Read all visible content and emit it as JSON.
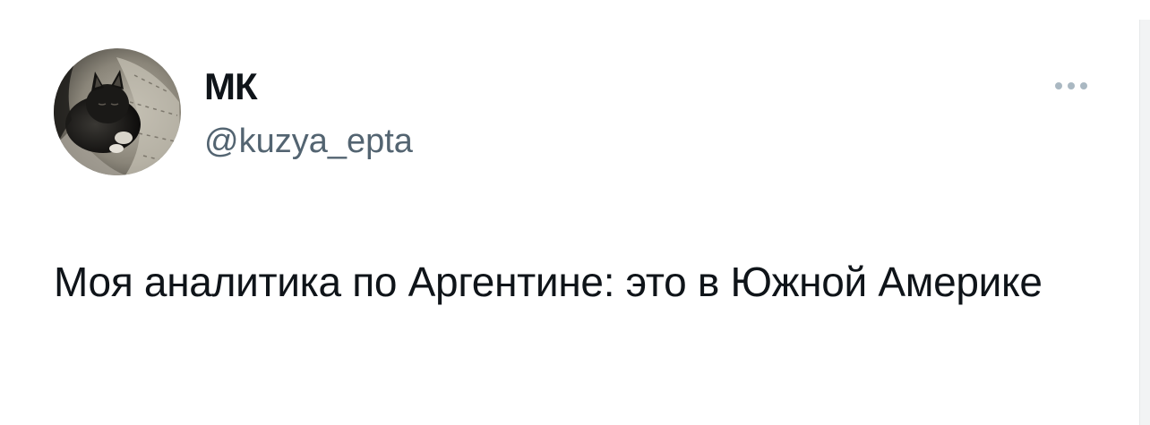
{
  "tweet": {
    "author": {
      "display_name": "МК",
      "handle": "@kuzya_epta",
      "avatar_icon": "cat-avatar-icon"
    },
    "more_icon": "more-options-icon",
    "text": "Моя аналитика по Аргентине: это в Южной Америке"
  },
  "colors": {
    "text_primary": "#0f1419",
    "text_secondary": "#536471",
    "icon_muted": "#aab8c2",
    "background": "#ffffff"
  }
}
